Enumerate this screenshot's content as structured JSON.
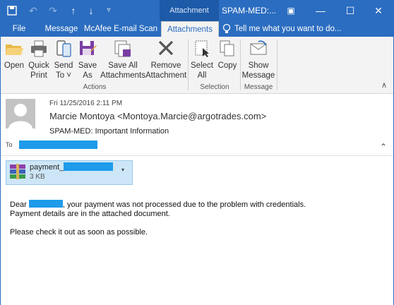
{
  "title_bar": {
    "context_tab": "Attachment Tools",
    "window_title": "SPAM-MED:..."
  },
  "tabs": [
    {
      "label": "File"
    },
    {
      "label": "Message"
    },
    {
      "label": "McAfee E-mail Scan"
    },
    {
      "label": "Attachments"
    }
  ],
  "tell_me": "Tell me what you want to do...",
  "ribbon": {
    "buttons": [
      {
        "label1": "Open",
        "label2": ""
      },
      {
        "label1": "Quick",
        "label2": "Print"
      },
      {
        "label1": "Send",
        "label2": "To ˅"
      },
      {
        "label1": "Save",
        "label2": "As"
      },
      {
        "label1": "Save All",
        "label2": "Attachments"
      },
      {
        "label1": "Remove",
        "label2": "Attachment"
      },
      {
        "label1": "Select",
        "label2": "All"
      },
      {
        "label1": "Copy",
        "label2": ""
      },
      {
        "label1": "Show",
        "label2": "Message"
      }
    ],
    "groups": [
      {
        "label": "Actions"
      },
      {
        "label": "Selection"
      },
      {
        "label": "Message"
      }
    ]
  },
  "message": {
    "date": "Fri 11/25/2016 2:11 PM",
    "from": "Marcie Montoya <Montoya.Marcie@argotrades.com>",
    "subject": "SPAM-MED:  Important Information",
    "to_label": "To"
  },
  "attachment": {
    "name": "payment_",
    "size": "3 KB"
  },
  "body": {
    "greeting": "Dear",
    "line1_rest": ", your payment was not processed due to the problem with credentials.",
    "line2": "Payment details are in the attached document.",
    "line3": "Please check it out as soon as possible."
  },
  "colors": {
    "accent": "#2b6dc0",
    "redaction": "#1e9bea"
  }
}
